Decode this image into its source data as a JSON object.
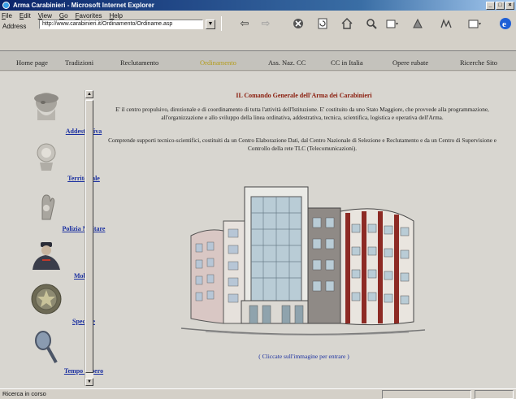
{
  "window": {
    "title": "Arma Carabinieri - Microsoft Internet Explorer",
    "controls": [
      "_",
      "□",
      "×"
    ]
  },
  "menu": [
    "File",
    "Edit",
    "View",
    "Go",
    "Favorites",
    "Help"
  ],
  "address": {
    "label": "Address",
    "url": "http://www.carabinieri.it/Ordinamento/Ordiname.asp"
  },
  "toolbar": {
    "icons": [
      "back-icon",
      "forward-icon",
      "stop-icon",
      "refresh-icon",
      "home-icon",
      "search-icon",
      "favorites-icon",
      "history-icon",
      "mail-icon",
      "print-icon",
      "edit-icon",
      "ie-icon"
    ]
  },
  "site_nav": [
    {
      "label": "Home page",
      "active": false
    },
    {
      "label": "Tradizioni",
      "active": false
    },
    {
      "label": "Reclutamento",
      "active": false
    },
    {
      "label": "Ordinamento",
      "active": true
    },
    {
      "label": "Ass. Naz. CC",
      "active": false
    },
    {
      "label": "CC in Italia",
      "active": false
    },
    {
      "label": "Opere rubate",
      "active": false
    },
    {
      "label": "Ricerche Sito",
      "active": false
    }
  ],
  "sidebar": [
    {
      "label": "Addestrativa",
      "icon": "helmet-bust-icon"
    },
    {
      "label": "Territoriale",
      "icon": "carabiniere-emblem-icon"
    },
    {
      "label": "Polizia Militare",
      "icon": "hand-icon"
    },
    {
      "label": "Mobile",
      "icon": "officer-icon"
    },
    {
      "label": "Speciale",
      "icon": "medal-icon"
    },
    {
      "label": "Tempo Libero",
      "icon": "tennis-racket-icon"
    }
  ],
  "main": {
    "title": "IL Comando Generale dell'Arma dei Carabinieri",
    "paragraph1": "E' il centro propulsivo, direzionale e di coordinamento di tutta l'attività dell'Istituzione. E' costituito da uno Stato Maggiore, che provvede alla programmazione, all'organizzazione e allo sviluppo della linea ordinativa, addestrativa, tecnica, scientifica, logistica e operativa dell'Arma.",
    "paragraph2": "Comprende supporti tecnico-scientifici, costituiti da un Centro Elaborazione Dati, dal Centro Nazionale di Selezione e Reclutamento e da un Centro di Supervisione e Controllo della rete TLC (Telecomunicazioni).",
    "image_caption": "( Cliccate sull'immagine per entrare )"
  },
  "status": {
    "text": "Ricerca in corso"
  },
  "colors": {
    "link": "#1a2fa0",
    "title": "#8a1c0c",
    "nav_active": "#b49c1c",
    "titlebar": "#0a246a"
  }
}
